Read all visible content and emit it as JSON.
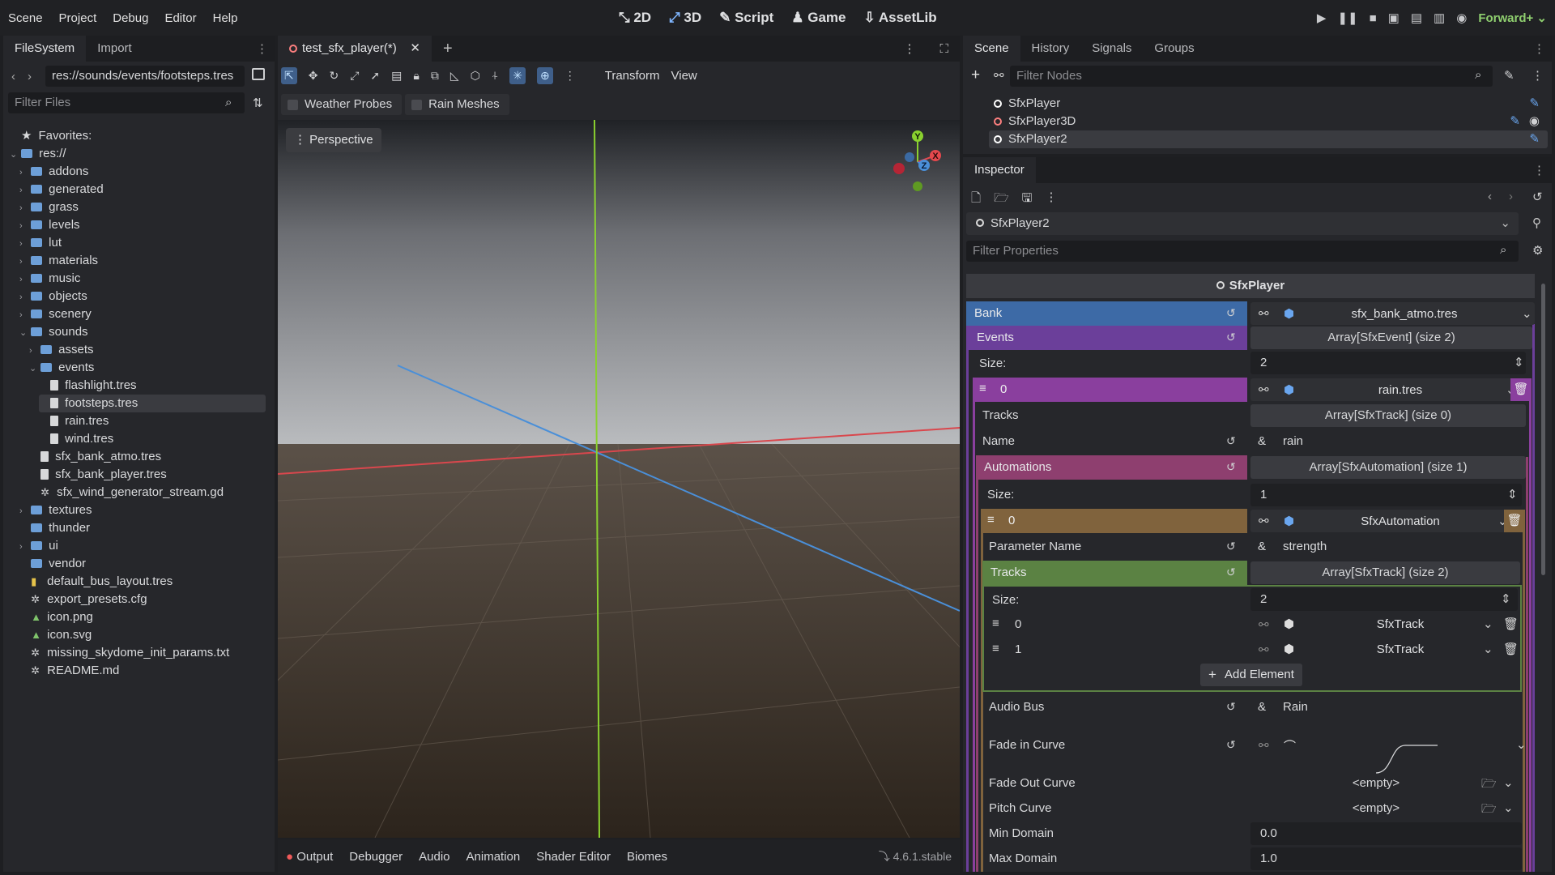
{
  "menubar": {
    "items": [
      "Scene",
      "Project",
      "Debug",
      "Editor",
      "Help"
    ],
    "workspaces": {
      "w2d": "2D",
      "w3d": "3D",
      "script": "Script",
      "game": "Game",
      "assetlib": "AssetLib"
    },
    "renderer": "Forward+"
  },
  "filesystem": {
    "tabs": [
      "FileSystem",
      "Import"
    ],
    "path": "res://sounds/events/footsteps.tres",
    "filter_placeholder": "Filter Files",
    "favorites": "Favorites:",
    "root": "res://",
    "items": [
      {
        "label": "addons",
        "type": "folder",
        "depth": 1
      },
      {
        "label": "generated",
        "type": "folder",
        "depth": 1
      },
      {
        "label": "grass",
        "type": "folder",
        "depth": 1
      },
      {
        "label": "levels",
        "type": "folder",
        "depth": 1
      },
      {
        "label": "lut",
        "type": "folder",
        "depth": 1
      },
      {
        "label": "materials",
        "type": "folder",
        "depth": 1
      },
      {
        "label": "music",
        "type": "folder",
        "depth": 1
      },
      {
        "label": "objects",
        "type": "folder",
        "depth": 1
      },
      {
        "label": "scenery",
        "type": "folder",
        "depth": 1
      },
      {
        "label": "sounds",
        "type": "folder",
        "depth": 1,
        "open": true
      },
      {
        "label": "assets",
        "type": "folder",
        "depth": 2
      },
      {
        "label": "events",
        "type": "folder",
        "depth": 2,
        "open": true
      },
      {
        "label": "flashlight.tres",
        "type": "file",
        "depth": 3
      },
      {
        "label": "footsteps.tres",
        "type": "file",
        "depth": 3,
        "selected": true
      },
      {
        "label": "rain.tres",
        "type": "file",
        "depth": 3
      },
      {
        "label": "wind.tres",
        "type": "file",
        "depth": 3
      },
      {
        "label": "sfx_bank_atmo.tres",
        "type": "file",
        "depth": 2
      },
      {
        "label": "sfx_bank_player.tres",
        "type": "file",
        "depth": 2
      },
      {
        "label": "sfx_wind_generator_stream.gd",
        "type": "gear",
        "depth": 2
      },
      {
        "label": "textures",
        "type": "folder",
        "depth": 1
      },
      {
        "label": "thunder",
        "type": "folder",
        "depth": 1,
        "nofold": true
      },
      {
        "label": "ui",
        "type": "folder",
        "depth": 1
      },
      {
        "label": "vendor",
        "type": "folder",
        "depth": 1,
        "nofold": true
      },
      {
        "label": "default_bus_layout.tres",
        "type": "bus",
        "depth": 1,
        "nofold": true
      },
      {
        "label": "export_presets.cfg",
        "type": "gear",
        "depth": 1,
        "nofold": true
      },
      {
        "label": "icon.png",
        "type": "img",
        "depth": 1,
        "nofold": true
      },
      {
        "label": "icon.svg",
        "type": "img",
        "depth": 1,
        "nofold": true
      },
      {
        "label": "missing_skydome_init_params.txt",
        "type": "gear",
        "depth": 1,
        "nofold": true
      },
      {
        "label": "README.md",
        "type": "gear",
        "depth": 1,
        "nofold": true
      }
    ]
  },
  "editor": {
    "scene_tab": "test_sfx_player(*)",
    "toolbar": {
      "transform": "Transform",
      "view": "View"
    },
    "toggles": [
      "Weather Probes",
      "Rain Meshes"
    ],
    "viewport_label": "Perspective",
    "gizmo": {
      "y": "Y",
      "x": "X",
      "z": "Z"
    }
  },
  "bottom": {
    "tabs": [
      "Output",
      "Debugger",
      "Audio",
      "Animation",
      "Shader Editor",
      "Biomes"
    ],
    "version": "4.6.1.stable"
  },
  "scene": {
    "tabs": [
      "Scene",
      "History",
      "Signals",
      "Groups"
    ],
    "filter_placeholder": "Filter Nodes",
    "nodes": [
      {
        "label": "SfxPlayer",
        "dot": "#ffffff"
      },
      {
        "label": "SfxPlayer3D",
        "dot": "#fc7f7f"
      },
      {
        "label": "SfxPlayer2",
        "dot": "#ffffff",
        "selected": true
      }
    ]
  },
  "inspector": {
    "title": "Inspector",
    "object": "SfxPlayer2",
    "filter_placeholder": "Filter Properties",
    "class_header": "SfxPlayer",
    "bank": {
      "label": "Bank",
      "value": "sfx_bank_atmo.tres"
    },
    "events": {
      "label": "Events",
      "value": "Array[SfxEvent] (size 2)",
      "size_label": "Size:",
      "size": "2"
    },
    "event0": {
      "index": "0",
      "value": "rain.tres"
    },
    "tracks": {
      "label": "Tracks",
      "value": "Array[SfxTrack] (size 0)"
    },
    "name": {
      "label": "Name",
      "prefix": "&",
      "value": "rain"
    },
    "automations": {
      "label": "Automations",
      "value": "Array[SfxAutomation] (size 1)",
      "size_label": "Size:",
      "size": "1"
    },
    "auto0": {
      "index": "0",
      "value": "SfxAutomation"
    },
    "param_name": {
      "label": "Parameter Name",
      "prefix": "&",
      "value": "strength"
    },
    "auto_tracks": {
      "label": "Tracks",
      "value": "Array[SfxTrack] (size 2)",
      "size_label": "Size:",
      "size": "2"
    },
    "track_items": [
      {
        "index": "0",
        "value": "SfxTrack"
      },
      {
        "index": "1",
        "value": "SfxTrack"
      }
    ],
    "add_element": "Add Element",
    "audio_bus": {
      "label": "Audio Bus",
      "prefix": "&",
      "value": "Rain"
    },
    "fade_in": {
      "label": "Fade in Curve"
    },
    "fade_out": {
      "label": "Fade Out Curve",
      "value": "<empty>"
    },
    "pitch": {
      "label": "Pitch Curve",
      "value": "<empty>"
    },
    "min_domain": {
      "label": "Min Domain",
      "value": "0.0"
    },
    "max_domain": {
      "label": "Max Domain",
      "value": "1.0"
    }
  },
  "colors": {
    "accent": "#6aa6ef",
    "bank": "#3d6aa6",
    "events": "#6b3f9a",
    "event0": "#8a3f9e",
    "automations": "#8e3f6f",
    "auto0": "#80633d",
    "tracks": "#5b8243"
  }
}
